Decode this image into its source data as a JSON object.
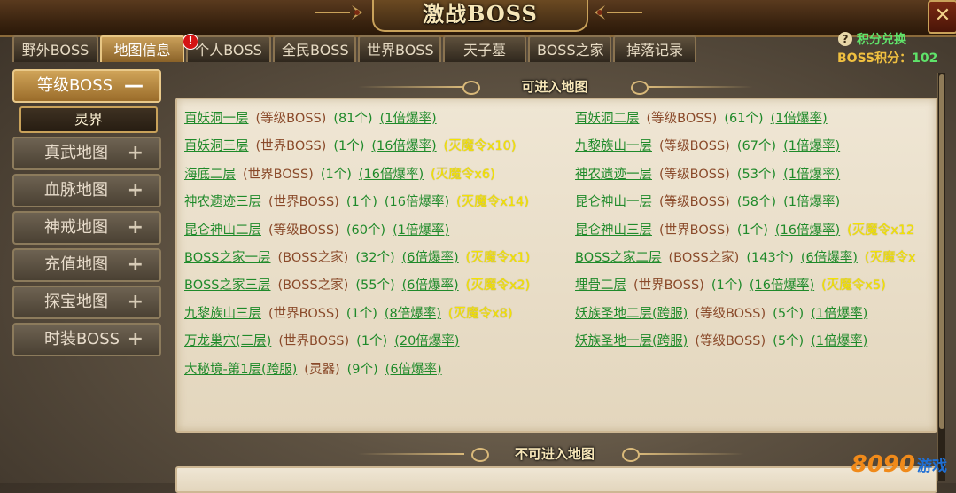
{
  "window": {
    "title": "激战BOSS",
    "close_label": "✕"
  },
  "tabs": [
    {
      "label": "野外BOSS",
      "active": false
    },
    {
      "label": "地图信息",
      "active": true
    },
    {
      "label": "个人BOSS",
      "active": false,
      "badge": "!"
    },
    {
      "label": "全民BOSS",
      "active": false
    },
    {
      "label": "世界BOSS",
      "active": false
    },
    {
      "label": "天子墓",
      "active": false
    },
    {
      "label": "BOSS之家",
      "active": false
    },
    {
      "label": "掉落记录",
      "active": false
    }
  ],
  "points": {
    "exchange_label": "积分兑换",
    "help_icon": "?",
    "label": "BOSS积分：",
    "value": "102"
  },
  "sidebar": {
    "items": [
      {
        "label": "等级BOSS",
        "toggle": "—",
        "expanded": true
      },
      {
        "label": "真武地图",
        "toggle": "+"
      },
      {
        "label": "血脉地图",
        "toggle": "+"
      },
      {
        "label": "神戒地图",
        "toggle": "+"
      },
      {
        "label": "充值地图",
        "toggle": "+"
      },
      {
        "label": "探宝地图",
        "toggle": "+"
      },
      {
        "label": "时装BOSS",
        "toggle": "+"
      }
    ],
    "sub_item": "灵界"
  },
  "sections": {
    "enterable_title": "可进入地图",
    "not_enterable_title": "不可进入地图"
  },
  "maps": [
    {
      "name": "百妖洞一层",
      "type": "(等级BOSS)",
      "count": "(81个)",
      "rate": "(1倍爆率)",
      "token": ""
    },
    {
      "name": "百妖洞二层",
      "type": "(等级BOSS)",
      "count": "(61个)",
      "rate": "(1倍爆率)",
      "token": ""
    },
    {
      "name": "百妖洞三层",
      "type": "(世界BOSS)",
      "count": "(1个)",
      "rate": "(16倍爆率)",
      "token": "(灭魔令x10)"
    },
    {
      "name": "九黎族山一层",
      "type": "(等级BOSS)",
      "count": "(67个)",
      "rate": "(1倍爆率)",
      "token": ""
    },
    {
      "name": "海底二层",
      "type": "(世界BOSS)",
      "count": "(1个)",
      "rate": "(16倍爆率)",
      "token": "(灭魔令x6)"
    },
    {
      "name": "神农遗迹一层",
      "type": "(等级BOSS)",
      "count": "(53个)",
      "rate": "(1倍爆率)",
      "token": ""
    },
    {
      "name": "神农遗迹三层",
      "type": "(世界BOSS)",
      "count": "(1个)",
      "rate": "(16倍爆率)",
      "token": "(灭魔令x14)"
    },
    {
      "name": "昆仑神山一层",
      "type": "(等级BOSS)",
      "count": "(58个)",
      "rate": "(1倍爆率)",
      "token": ""
    },
    {
      "name": "昆仑神山二层",
      "type": "(等级BOSS)",
      "count": "(60个)",
      "rate": "(1倍爆率)",
      "token": ""
    },
    {
      "name": "昆仑神山三层",
      "type": "(世界BOSS)",
      "count": "(1个)",
      "rate": "(16倍爆率)",
      "token": "(灭魔令x12"
    },
    {
      "name": "BOSS之家一层",
      "type": "(BOSS之家)",
      "count": "(32个)",
      "rate": "(6倍爆率)",
      "token": "(灭魔令x1)"
    },
    {
      "name": "BOSS之家二层",
      "type": "(BOSS之家)",
      "count": "(143个)",
      "rate": "(6倍爆率)",
      "token": "(灭魔令x"
    },
    {
      "name": "BOSS之家三层",
      "type": "(BOSS之家)",
      "count": "(55个)",
      "rate": "(6倍爆率)",
      "token": "(灭魔令x2)"
    },
    {
      "name": "埋骨二层",
      "type": "(世界BOSS)",
      "count": "(1个)",
      "rate": "(16倍爆率)",
      "token": "(灭魔令x5)"
    },
    {
      "name": "九黎族山三层",
      "type": "(世界BOSS)",
      "count": "(1个)",
      "rate": "(8倍爆率)",
      "token": "(灭魔令x8)"
    },
    {
      "name": "妖族圣地二层(跨服)",
      "type": "(等级BOSS)",
      "count": "(5个)",
      "rate": "(1倍爆率)",
      "token": ""
    },
    {
      "name": "万龙巢穴(三层)",
      "type": "(世界BOSS)",
      "count": "(1个)",
      "rate": "(20倍爆率)",
      "token": ""
    },
    {
      "name": "妖族圣地一层(跨服)",
      "type": "(等级BOSS)",
      "count": "(5个)",
      "rate": "(1倍爆率)",
      "token": ""
    },
    {
      "name": "大秘境-第1层(跨服)",
      "type": "(灵器)",
      "count": "(9个)",
      "rate": "(6倍爆率)",
      "token": ""
    }
  ],
  "watermark": {
    "number": "8090",
    "text": "游戏"
  },
  "colors": {
    "link_green": "#1f8a2a",
    "type_brown": "#8a4a2a",
    "token_yellow": "#f5e400",
    "points_value": "#5fe36a",
    "tab_active": "#caa05a"
  }
}
